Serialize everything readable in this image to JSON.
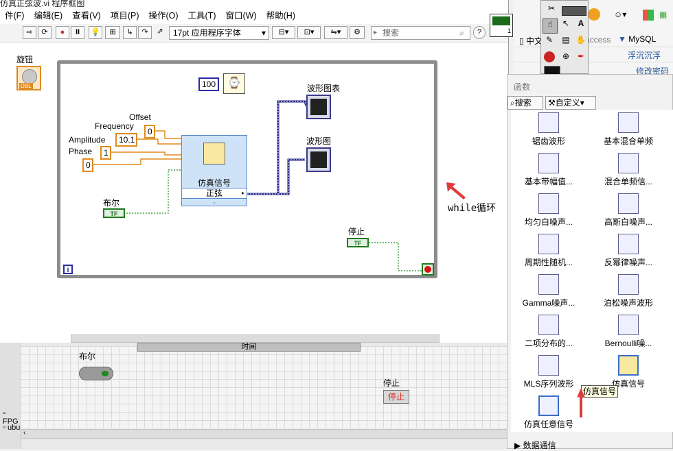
{
  "window": {
    "title": "仿真正弦波.vi 程序框图"
  },
  "menu": [
    "件(F)",
    "编辑(E)",
    "查看(V)",
    "项目(P)",
    "操作(O)",
    "工具(T)",
    "窗口(W)",
    "帮助(H)"
  ],
  "toolbar": {
    "font": "17pt 应用程序字体",
    "search_placeholder": "搜索"
  },
  "left_panel": {
    "knob_label": "旋钮",
    "knob_tag": "DBL"
  },
  "diagram": {
    "timer_const": "100",
    "labels": {
      "offset": "Offset",
      "frequency": "Frequency",
      "amplitude": "Amplitude",
      "phase": "Phase"
    },
    "values": {
      "offset": "0",
      "frequency": "10.1",
      "amplitude": "1",
      "phase": "0"
    },
    "sim_block": {
      "title": "仿真信号",
      "mode": "正弦"
    },
    "waveform_chart": "波形图表",
    "waveform_graph": "波形图",
    "bool_label": "布尔",
    "bool_term": "TF",
    "stop_label": "停止",
    "stop_term": "TF",
    "loop_index": "i",
    "annotation": "while循环"
  },
  "front_panel": {
    "bool_label": "布尔",
    "stop_label": "停止",
    "stop_button": "停止",
    "time_label": "时间",
    "side_items": [
      "FPG",
      "ubu"
    ]
  },
  "browser": {
    "tab1": "中文",
    "tab2": "access",
    "tab3": "MySQL",
    "link1": "浮沉沉浮",
    "link2": "修改密码"
  },
  "functions_palette": {
    "title": "函数",
    "search_button": "搜索",
    "custom_button": "自定义",
    "items": [
      "锯齿波形",
      "基本混合单频",
      "基本带幅值...",
      "混合单频信...",
      "均匀白噪声...",
      "高斯白噪声...",
      "周期性随机...",
      "反幂律噪声...",
      "Gamma噪声...",
      "泊松噪声波形",
      "二项分布的...",
      "Bernoulli噪...",
      "MLS序列波形",
      "仿真信号",
      "仿真任意信号"
    ],
    "tooltip": "仿真信号",
    "bottom_category": "数据通信"
  }
}
